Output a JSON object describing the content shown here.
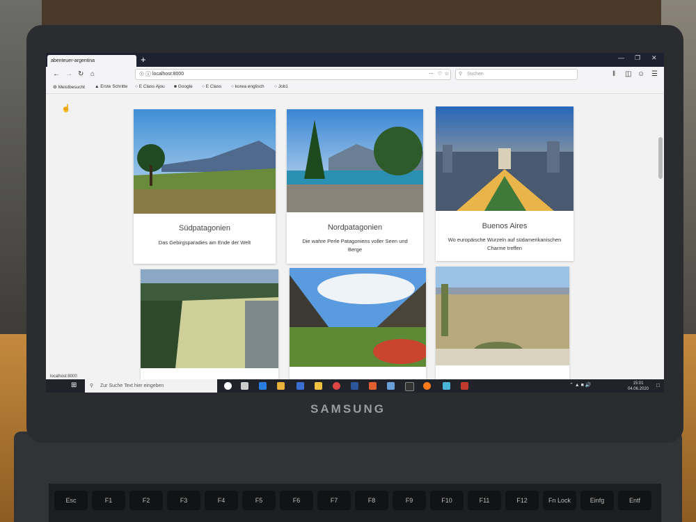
{
  "browser": {
    "tab_title": "abenteuer-argentina",
    "new_tab": "+",
    "url": "localhost:8000",
    "search_placeholder": "Suchen",
    "bookmarks": [
      "Meistbesucht",
      "Erste Schritte",
      "E Class Ajou",
      "Google",
      "E Class",
      "korea englisch",
      "Job1"
    ],
    "status_url": "localhost:8000"
  },
  "cards": [
    {
      "title": "Südpatagonien",
      "desc": "Das Gebirgsparadies am Ende der Welt"
    },
    {
      "title": "Nordpatagonien",
      "desc": "Die wahre Perle Patagoniens voller Seen und Berge"
    },
    {
      "title": "Buenos Aires",
      "desc": "Wo europäische Wurzeln auf südamerikanischen Charme treffen"
    },
    {
      "title": "",
      "desc": ""
    },
    {
      "title": "",
      "desc": ""
    },
    {
      "title": "",
      "desc": ""
    }
  ],
  "taskbar": {
    "search_placeholder": "Zur Suche Text hier eingeben",
    "time": "15:01",
    "date": "04.06.2020"
  },
  "laptop": {
    "brand": "SAMSUNG"
  },
  "keys": [
    "Esc",
    "F1",
    "F2",
    "F3",
    "F4",
    "F5",
    "F6",
    "F7",
    "F8",
    "F9",
    "F10",
    "F11",
    "F12",
    "Fn Lock",
    "Einfg",
    "Entf"
  ]
}
